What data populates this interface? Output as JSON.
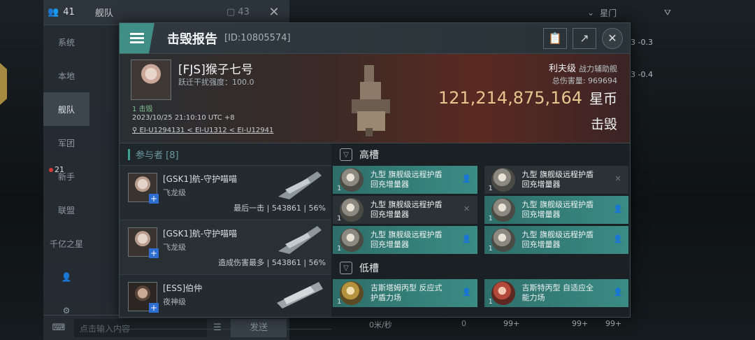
{
  "background": {
    "side": {
      "member_count": "41",
      "title": "舰队",
      "count2": "43",
      "nav": [
        "系统",
        "本地",
        "舰队",
        "军团",
        "新手",
        "联盟",
        "千亿之星"
      ],
      "active_index": 2,
      "badge": "21",
      "input_placeholder": "点击输入内容",
      "send_label": "发送"
    },
    "right_top": {
      "filter_label": "星门"
    },
    "right_numbers": [
      "3 -0.3",
      "3 -0.4"
    ],
    "footer_numbers": [
      "0米/秒",
      "0",
      "99+",
      "99+",
      "99+"
    ]
  },
  "dialog": {
    "title": "击毁报告",
    "id_text": "[ID:10805574]",
    "victim": {
      "name": "[FJS]猴子七号",
      "jump_text": "跃迁干扰强度：100.0",
      "kill_label": "1 击毁",
      "time": "2023/10/25 21:10:10 UTC +8",
      "location": "EI-U1294131 < EI-U1312 < EI-U12941",
      "ship": "利夫级",
      "ship_class": "战力辅助舰",
      "damage_label": "总伤害量: 969694",
      "value": "121,214,875,164",
      "currency": "星币",
      "status": "击毁"
    },
    "participants_header": "参与者 [8]",
    "participants": [
      {
        "name": "[GSK1]航-守护喵喵",
        "ship": "飞龙级",
        "stat": "最后一击 | 543861 | 56%"
      },
      {
        "name": "[GSK1]航-守护喵喵",
        "ship": "飞龙级",
        "stat": "造成伤害最多 | 543861 | 56%"
      },
      {
        "name": "[ESS]伯仲",
        "ship": "夜神级",
        "stat": ""
      }
    ],
    "high_slot_label": "高槽",
    "high_slots": [
      {
        "name": "九型 旗舰级远程护盾回充增量器",
        "qty": "1",
        "state": "on"
      },
      {
        "name": "九型 旗舰级远程护盾回充增量器",
        "qty": "1",
        "state": "off"
      },
      {
        "name": "九型 旗舰级远程护盾回充增量器",
        "qty": "1",
        "state": "off"
      },
      {
        "name": "九型 旗舰级远程护盾回充增量器",
        "qty": "1",
        "state": "on"
      },
      {
        "name": "九型 旗舰级远程护盾回充增量器",
        "qty": "1",
        "state": "on"
      },
      {
        "name": "九型 旗舰级远程护盾回充增量器",
        "qty": "1",
        "state": "on"
      }
    ],
    "low_slot_label": "低槽",
    "low_slots": [
      {
        "name": "吉斯塔姆丙型 反应式护盾力场",
        "qty": "1",
        "state": "on"
      },
      {
        "name": "吉斯特丙型 自适应全能力场",
        "qty": "1",
        "state": "on"
      }
    ]
  }
}
